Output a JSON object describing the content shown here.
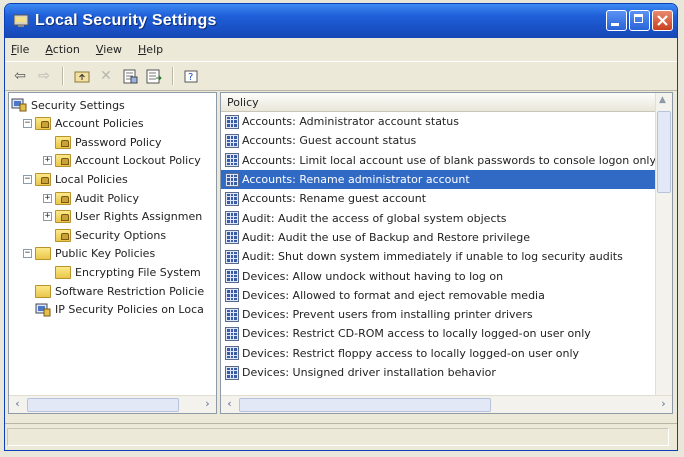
{
  "window": {
    "title": "Local Security Settings"
  },
  "menu": [
    "File",
    "Action",
    "View",
    "Help"
  ],
  "toolbar": {
    "icons": [
      "back-arrow-icon",
      "forward-arrow-icon",
      "up-folder-icon",
      "delete-icon",
      "properties-icon",
      "export-list-icon",
      "help-icon"
    ]
  },
  "tree": {
    "items": [
      {
        "label": "Security Settings",
        "level": 0,
        "expander": "",
        "icon": "security-settings-icon"
      },
      {
        "label": "Account Policies",
        "level": 1,
        "expander": "−",
        "icon": "folder-lock-icon"
      },
      {
        "label": "Password Policy",
        "level": 2,
        "expander": "",
        "icon": "folder-lock-icon"
      },
      {
        "label": "Account Lockout Policy",
        "level": 2,
        "expander": "+",
        "icon": "folder-lock-icon"
      },
      {
        "label": "Local Policies",
        "level": 1,
        "expander": "−",
        "icon": "folder-lock-icon"
      },
      {
        "label": "Audit Policy",
        "level": 2,
        "expander": "+",
        "icon": "folder-lock-icon"
      },
      {
        "label": "User Rights Assignmen",
        "level": 2,
        "expander": "+",
        "icon": "folder-lock-icon"
      },
      {
        "label": "Security Options",
        "level": 2,
        "expander": "",
        "icon": "folder-lock-icon"
      },
      {
        "label": "Public Key Policies",
        "level": 1,
        "expander": "−",
        "icon": "folder-icon"
      },
      {
        "label": "Encrypting File System",
        "level": 2,
        "expander": "",
        "icon": "folder-icon"
      },
      {
        "label": "Software Restriction Policie",
        "level": 1,
        "expander": "",
        "icon": "folder-icon"
      },
      {
        "label": "IP Security Policies on Loca",
        "level": 1,
        "expander": "",
        "icon": "ip-security-icon"
      }
    ]
  },
  "list": {
    "column_header": "Policy",
    "selected_index": 3,
    "rows": [
      "Accounts: Administrator account status",
      "Accounts: Guest account status",
      "Accounts: Limit local account use of blank passwords to console logon only",
      "Accounts: Rename administrator account",
      "Accounts: Rename guest account",
      "Audit: Audit the access of global system objects",
      "Audit: Audit the use of Backup and Restore privilege",
      "Audit: Shut down system immediately if unable to log security audits",
      "Devices: Allow undock without having to log on",
      "Devices: Allowed to format and eject removable media",
      "Devices: Prevent users from installing printer drivers",
      "Devices: Restrict CD-ROM access to locally logged-on user only",
      "Devices: Restrict floppy access to locally logged-on user only",
      "Devices: Unsigned driver installation behavior"
    ]
  },
  "colors": {
    "title_bar": "#1f5fd9",
    "selection": "#316ac5"
  }
}
